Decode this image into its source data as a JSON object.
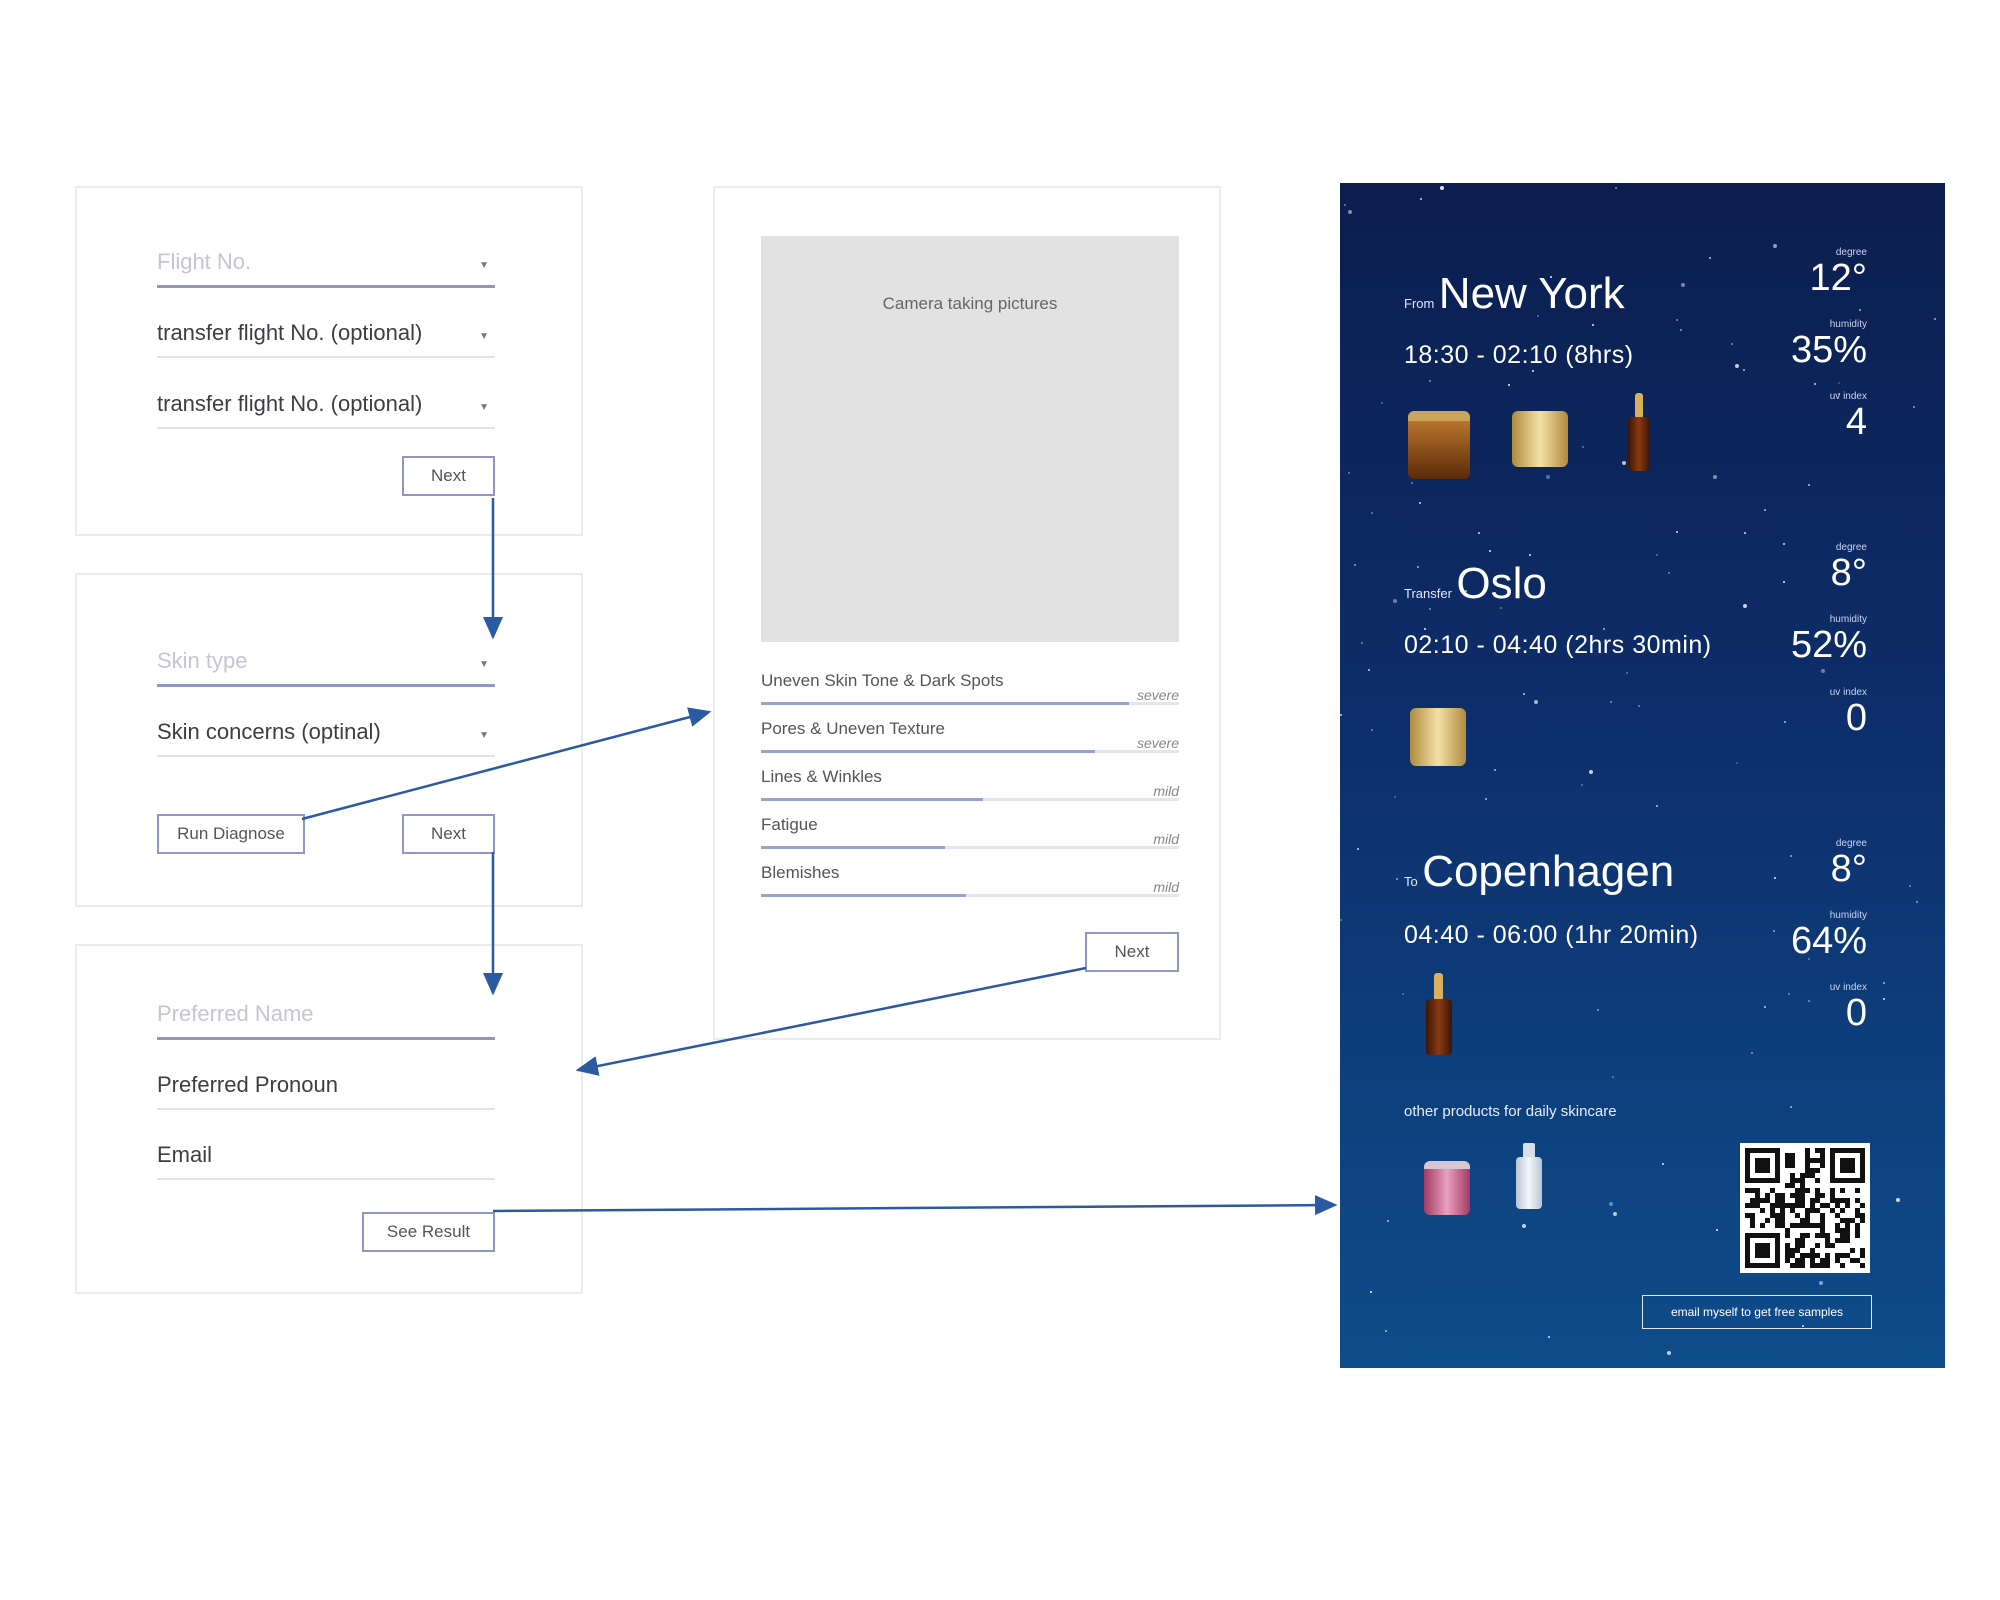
{
  "flight_form": {
    "flight_no": "Flight No.",
    "transfer_1": "transfer flight No. (optional)",
    "transfer_2": "transfer flight No. (optional)",
    "next": "Next"
  },
  "skin_form": {
    "skin_type": "Skin type",
    "skin_concerns": "Skin concerns (optinal)",
    "run_diagnose": "Run Diagnose",
    "next": "Next"
  },
  "profile_form": {
    "preferred_name": "Preferred Name",
    "preferred_pronoun": "Preferred Pronoun",
    "email": "Email",
    "see_result": "See Result"
  },
  "diagnosis": {
    "camera_label": "Camera taking pictures",
    "concerns": [
      {
        "name": "Uneven Skin Tone & Dark Spots",
        "severity": "severe",
        "level": 0.88
      },
      {
        "name": "Pores & Uneven Texture",
        "severity": "severe",
        "level": 0.8
      },
      {
        "name": "Lines & Winkles",
        "severity": "mild",
        "level": 0.53
      },
      {
        "name": "Fatigue",
        "severity": "mild",
        "level": 0.44
      },
      {
        "name": "Blemishes",
        "severity": "mild",
        "level": 0.49
      }
    ],
    "next": "Next"
  },
  "result": {
    "legs": [
      {
        "prefix": "From",
        "city": "New York",
        "time": "18:30 - 02:10 (8hrs)",
        "degree_label": "degree",
        "degree": "12°",
        "humidity_label": "humidity",
        "humidity": "35%",
        "uv_label": "uv index",
        "uv": "4"
      },
      {
        "prefix": "Transfer",
        "city": "Oslo",
        "time": "02:10 - 04:40 (2hrs 30min)",
        "degree_label": "degree",
        "degree": "8°",
        "humidity_label": "humidity",
        "humidity": "52%",
        "uv_label": "uv index",
        "uv": "0"
      },
      {
        "prefix": "To",
        "city": "Copenhagen",
        "time": "04:40 - 06:00 (1hr 20min)",
        "degree_label": "degree",
        "degree": "8°",
        "humidity_label": "humidity",
        "humidity": "64%",
        "uv_label": "uv index",
        "uv": "0"
      }
    ],
    "other_products": "other products for daily skincare",
    "email_button": "email myself to get free samples"
  }
}
